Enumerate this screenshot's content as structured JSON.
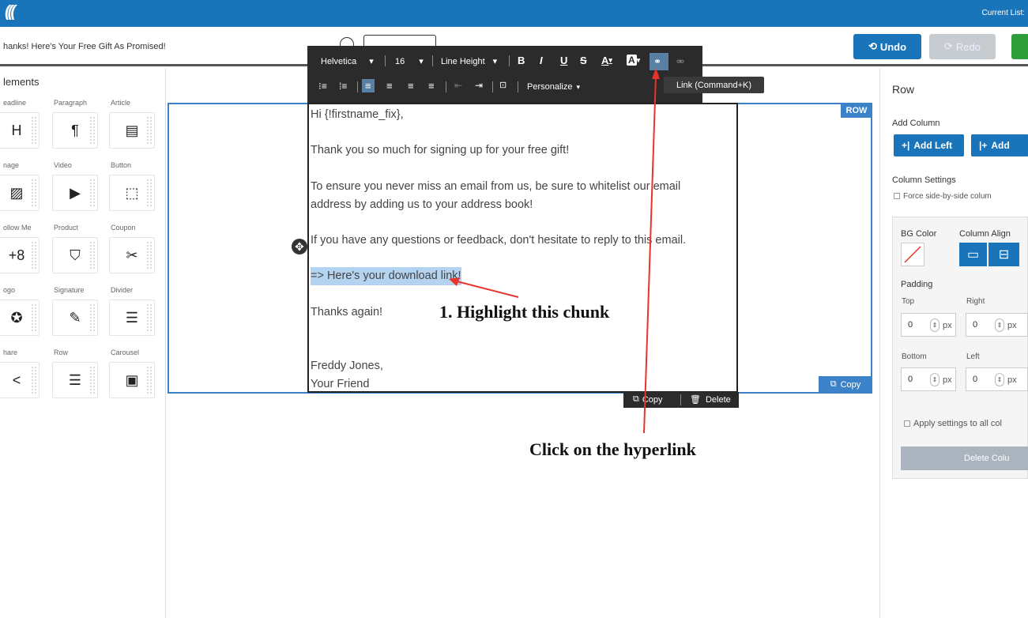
{
  "topbar": {
    "current_list": "Current List:"
  },
  "subbar": {
    "subject": "hanks! Here's Your Free Gift As Promised!",
    "undo_label": "Undo",
    "redo_label": "Redo"
  },
  "left_panel": {
    "title": "lements",
    "elements": [
      {
        "label": "eadline",
        "icon": "H"
      },
      {
        "label": "Paragraph",
        "icon": "¶"
      },
      {
        "label": "Article",
        "icon": "▤"
      },
      {
        "label": "nage",
        "icon": "▨"
      },
      {
        "label": "Video",
        "icon": "▶"
      },
      {
        "label": "Button",
        "icon": "⬚"
      },
      {
        "label": "ollow Me",
        "icon": "+8"
      },
      {
        "label": "Product",
        "icon": "⛉"
      },
      {
        "label": "Coupon",
        "icon": "✂"
      },
      {
        "label": "ogo",
        "icon": "✪"
      },
      {
        "label": "Signature",
        "icon": "✎"
      },
      {
        "label": "Divider",
        "icon": "☰"
      },
      {
        "label": "hare",
        "icon": "<"
      },
      {
        "label": "Row",
        "icon": "☰"
      },
      {
        "label": "Carousel",
        "icon": "▣"
      }
    ]
  },
  "toolbar": {
    "font": "Helvetica",
    "size": "16",
    "line_height": "Line Height",
    "bold": "B",
    "italic": "I",
    "underline": "U",
    "strike": "S",
    "text_color": "A",
    "bg_color": "A",
    "personalize": "Personalize",
    "link_tooltip": "Link (Command+K)"
  },
  "editor": {
    "lines": [
      "Hi {!firstname_fix},",
      "Thank you so much for signing up for your free gift!",
      "To ensure you never miss an email from us, be sure to whitelist our email",
      "address by adding us to your address book!",
      "If you have any questions or feedback, don't hesitate to reply to this email.",
      "=> Here's your download link!",
      "Thanks again!",
      "Freddy Jones,",
      "Your Friend"
    ]
  },
  "canvas": {
    "row_tag": "ROW",
    "copy_tag": "Copy",
    "copy_label": "Copy",
    "delete_label": "Delete"
  },
  "right_panel": {
    "title": "Row",
    "add_column": "Add Column",
    "add_left": "Add Left",
    "add_right": "Add",
    "column_settings": "Column Settings",
    "force_side": "Force side-by-side colum",
    "bg_color": "BG Color",
    "column_align": "Column Align",
    "padding": "Padding",
    "top": "Top",
    "right": "Right",
    "bottom": "Bottom",
    "left": "Left",
    "top_val": "0",
    "right_val": "0",
    "bottom_val": "0",
    "left_val": "0",
    "unit": "px",
    "apply_all": "Apply settings to all col",
    "delete_column": "Delete Colu"
  },
  "annotations": {
    "step1": "1. Highlight this chunk",
    "step2": "Click on the hyperlink"
  },
  "colors": {
    "brand": "#1a74ba",
    "highlight": "#b4d3f0",
    "arrow": "#e8332a"
  }
}
